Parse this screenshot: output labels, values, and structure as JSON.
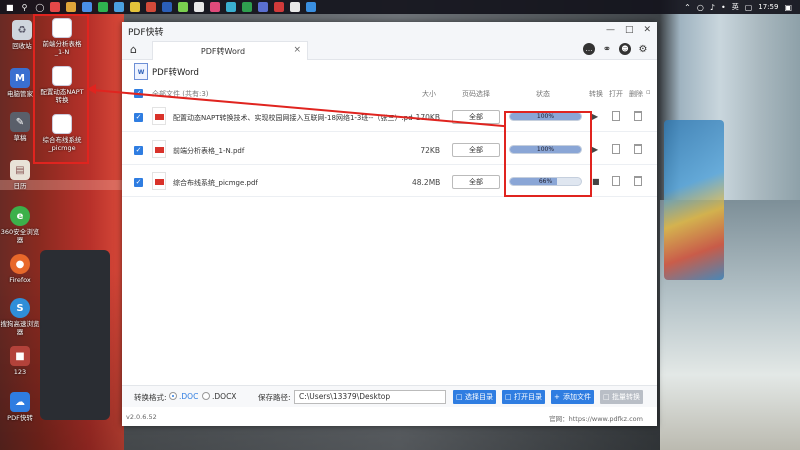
{
  "taskbar": {
    "time": "17:59",
    "ime": "英",
    "ime_symbol": "•"
  },
  "desktop": {
    "icons": [
      {
        "label": "回收站"
      },
      {
        "label": "电脑管家"
      },
      {
        "label": "草稿"
      },
      {
        "label": "日历"
      },
      {
        "label": "360安全浏览器"
      },
      {
        "label": "Firefox"
      },
      {
        "label": "搜狗高速浏览器"
      },
      {
        "label": "123"
      },
      {
        "label": "PDF快转"
      }
    ],
    "word_files": [
      {
        "label": "前端分析表格_1-N"
      },
      {
        "label": "配置动态NAPT转换"
      },
      {
        "label": "综合布线系统_picmge"
      }
    ]
  },
  "app": {
    "title": "PDF快转",
    "tab_label": "PDF转Word",
    "tab_close": "×",
    "mode_label": "PDF转Word",
    "mode_icon_text": "W",
    "columns": {
      "select_all": "全部文件 (共有:3)",
      "size": "大小",
      "page_range": "页码选择",
      "status": "状态",
      "convert": "转换",
      "open": "打开",
      "delete": "删除"
    },
    "files": [
      {
        "name": "配置动态NAPT转换技术、实现校园网接入互联网-18网络1-3班--（张三）.pdf",
        "size": "170KB",
        "range": "全部",
        "progress": 100,
        "progress_label": "100%",
        "action": "▶"
      },
      {
        "name": "前端分析表格_1-N.pdf",
        "size": "72KB",
        "range": "全部",
        "progress": 100,
        "progress_label": "100%",
        "action": "▶"
      },
      {
        "name": "综合布线系统_picmge.pdf",
        "size": "48.2MB",
        "range": "全部",
        "progress": 66,
        "progress_label": "66%",
        "action": "■"
      }
    ],
    "format_label": "转换格式:",
    "format_doc": ".DOC",
    "format_docx": ".DOCX",
    "format_selected": ".DOC",
    "save_path_label": "保存路径:",
    "save_path": "C:\\Users\\13379\\Desktop",
    "buttons": {
      "choose_dir": "选择目录",
      "open_dir": "打开目录",
      "add_file": "添加文件",
      "batch_convert": "批量转换"
    },
    "version": "v2.0.6.52",
    "website": "官网：https://www.pdfkz.com"
  }
}
